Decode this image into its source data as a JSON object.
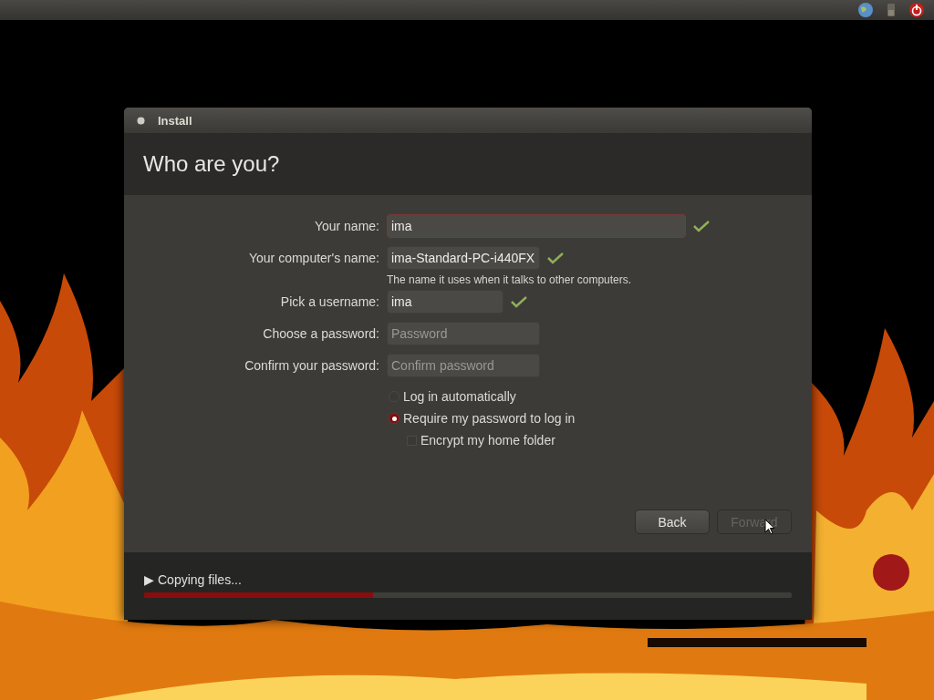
{
  "window": {
    "title": "Install"
  },
  "heading": "Who are you?",
  "fields": [
    {
      "label": "Your name:",
      "value": "ima",
      "valid": true,
      "focused": true
    },
    {
      "label": "Your computer's name:",
      "value": "ima-Standard-PC-i440FX",
      "valid": true,
      "focused": false,
      "hint": "The name it uses when it talks to other computers."
    },
    {
      "label": "Pick a username:",
      "value": "ima",
      "valid": true,
      "focused": false
    },
    {
      "label": "Choose a password:",
      "placeholder": "Password",
      "valid": false,
      "focused": false
    },
    {
      "label": "Confirm your password:",
      "placeholder": "Confirm password",
      "valid": false,
      "focused": false
    }
  ],
  "login_options": [
    {
      "label": "Log in automatically",
      "selected": false
    },
    {
      "label": "Require my password to log in",
      "selected": true
    }
  ],
  "encrypt": {
    "label": "Encrypt my home folder",
    "checked": false
  },
  "buttons": [
    {
      "label": "Back",
      "disabled": false
    },
    {
      "label": "Forward",
      "disabled": true
    }
  ],
  "progress": {
    "label": "Copying files...",
    "expander": "▶",
    "level": 0.353
  }
}
